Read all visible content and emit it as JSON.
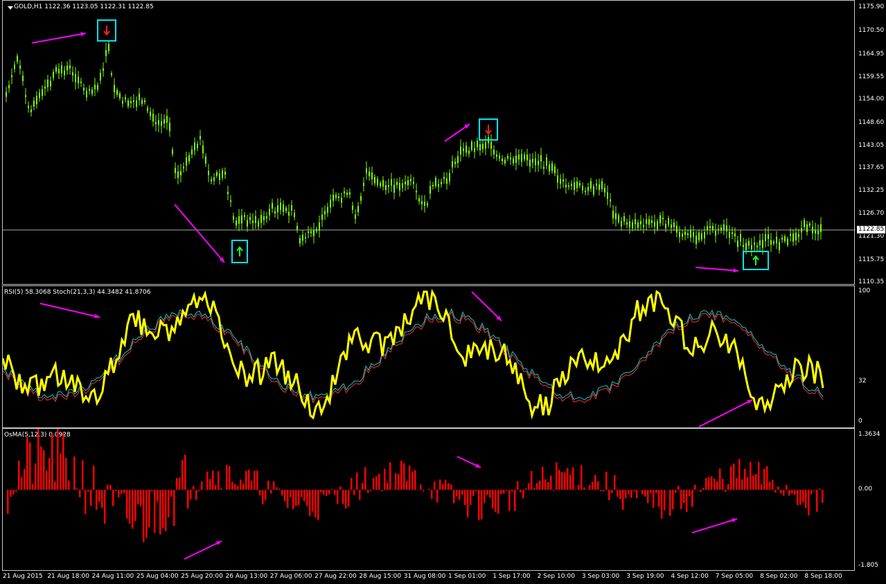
{
  "main": {
    "title": "GOLD,H1  1122.36 1123.05 1122.31 1122.85",
    "price_levels": [
      "1175.90",
      "1170.50",
      "1164.95",
      "1159.55",
      "1154.00",
      "1148.60",
      "1143.05",
      "1137.65",
      "1132.25",
      "1126.70",
      "1121.30",
      "1115.75",
      "1110.35"
    ],
    "current_price": "1122.85",
    "candle_color": "#7CFC00",
    "signal_box_color": "#00E5EE",
    "arrow_color": "#FF00FF"
  },
  "rsi_pane": {
    "title": "RSI(5) 58.3068  Stoch(21,3,3) 44.3482 41.8706",
    "levels": [
      "100",
      "32",
      "0"
    ],
    "rsi_color": "#FFFF00",
    "stoch_main_color": "#00CED1",
    "stoch_signal_color": "#FF3030"
  },
  "osma_pane": {
    "title": "OsMA(5,12,3) 0.0928",
    "levels": [
      "1.3634",
      "0.00",
      "-1.805"
    ],
    "bar_color": "#FF0000"
  },
  "time_axis": [
    "21 Aug 2015",
    "21 Aug 18:00",
    "24 Aug 11:00",
    "25 Aug 04:00",
    "25 Aug 20:00",
    "26 Aug 13:00",
    "27 Aug 06:00",
    "27 Aug 22:00",
    "28 Aug 15:00",
    "31 Aug 08:00",
    "1 Sep 01:00",
    "1 Sep 17:00",
    "2 Sep 10:00",
    "3 Sep 03:00",
    "3 Sep 19:00",
    "4 Sep 12:00",
    "7 Sep 05:00",
    "8 Sep 02:00",
    "8 Sep 18:00"
  ]
}
